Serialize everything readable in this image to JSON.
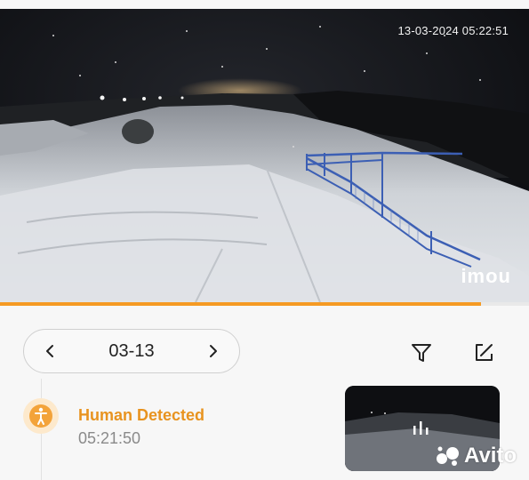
{
  "camera": {
    "timestamp": "13-03-2024 05:22:51",
    "brand": "imou",
    "playback_progress": 0.91
  },
  "date_selector": {
    "date": "03-13",
    "prev_icon": "chevron-left-icon",
    "next_icon": "chevron-right-icon"
  },
  "toolbar": {
    "filter_icon": "filter-icon",
    "edit_icon": "edit-icon"
  },
  "events": [
    {
      "type": "Human Detected",
      "time": "05:21:50",
      "icon": "human-icon"
    }
  ],
  "watermark": {
    "text": "Avito"
  },
  "colors": {
    "accent": "#f59a23",
    "event_title": "#e8931f",
    "event_icon_bg": "#fde9cc"
  }
}
